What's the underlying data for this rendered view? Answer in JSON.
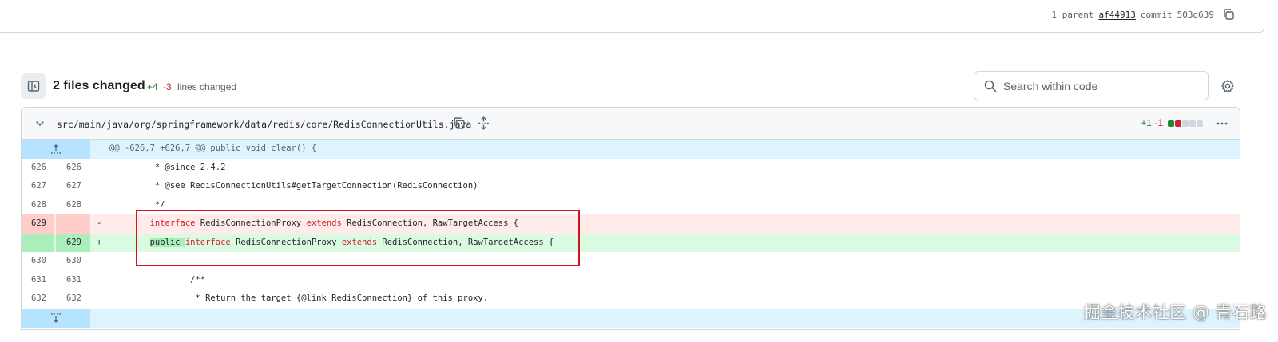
{
  "commit": {
    "parent_count": "1 parent",
    "parent_sha": "af44913",
    "commit_label": "commit",
    "commit_sha": "503d639"
  },
  "toolbar": {
    "files_changed": "2 files changed",
    "additions": "+4",
    "deletions": "-3",
    "lines_changed": "lines changed",
    "search_placeholder": "Search within code"
  },
  "file": {
    "path": "src/main/java/org/springframework/data/redis/core/RedisConnectionUtils.java",
    "additions": "+1",
    "deletions": "-1"
  },
  "hunk_header": "@@ -626,7 +626,7 @@ public void clear() {",
  "lines": [
    {
      "old": "626",
      "new": "626",
      "sign": "",
      "text": "         * @since 2.4.2"
    },
    {
      "old": "627",
      "new": "627",
      "sign": "",
      "text": "         * @see RedisConnectionUtils#getTargetConnection(RedisConnection)"
    },
    {
      "old": "628",
      "new": "628",
      "sign": "",
      "text": "         */"
    },
    {
      "old": "629",
      "new": "",
      "sign": "-",
      "kw1": "interface",
      "mid": " RedisConnectionProxy ",
      "kw2": "extends",
      "rest": " RedisConnection, RawTargetAccess {"
    },
    {
      "old": "",
      "new": "629",
      "sign": "+",
      "pub": "public",
      "kw1": "interface",
      "mid": " RedisConnectionProxy ",
      "kw2": "extends",
      "rest": " RedisConnection, RawTargetAccess {"
    },
    {
      "old": "630",
      "new": "630",
      "sign": "",
      "text": ""
    },
    {
      "old": "631",
      "new": "631",
      "sign": "",
      "text": "                /**"
    },
    {
      "old": "632",
      "new": "632",
      "sign": "",
      "text": "                 * Return the target {@link RedisConnection} of this proxy."
    }
  ],
  "watermark": "掘金技术社区 @ 青石路",
  "colors": {
    "addition": "#1a7f37",
    "deletion": "#d1242f",
    "highlight_box": "#d0141e",
    "hunk_bg": "#ddf4ff"
  }
}
